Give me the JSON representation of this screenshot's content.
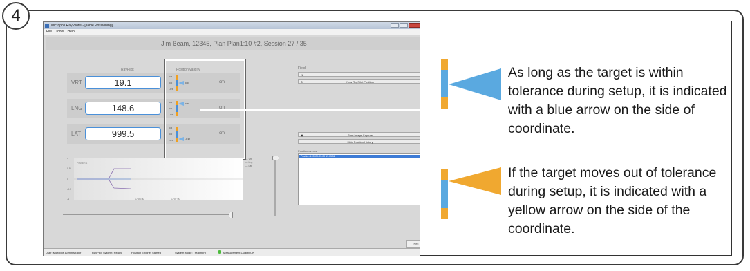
{
  "step_number": "4",
  "window": {
    "title": "Micropos RayPilot® - [Table Positioning]",
    "menu": [
      "File",
      "Tools",
      "Help"
    ],
    "header": "Jim Beam, 12345, Plan Plan1:10 #2, Session 27 / 35",
    "col_raypilot": "RayPilot",
    "col_position_validity": "Position validity",
    "rows": [
      {
        "label": "VRT",
        "value": "19.1",
        "unit": "cm",
        "pv_value": "0.03"
      },
      {
        "label": "LNG",
        "value": "148.6",
        "unit": "cm",
        "pv_value": "0.50"
      },
      {
        "label": "LAT",
        "value": "999.5",
        "unit": "cm",
        "pv_value": "-0.38"
      }
    ],
    "pv_ticks": [
      "0.5",
      "0.0",
      "-0.5"
    ],
    "field_label": "Field",
    "field_value": "f1",
    "new_position_button": "New RayPilot Position",
    "start_capture_button": "Start Image Capture",
    "hide_history_button": "Hide Position History",
    "events_label": "Position events",
    "events_selected": "Position 1: 2020-05-29 17:05:52",
    "chart_title": "Position 1",
    "chart_y_ticks": [
      "1",
      "0.5",
      "0",
      "-0.5",
      "-1"
    ],
    "chart_x_ticks": [
      "17:06:30",
      "17:07:00"
    ],
    "legend": [
      "Vrt",
      "Lng",
      "Lat"
    ],
    "next_button": "Nex",
    "status": [
      "User: Micropos Administrator",
      "RayPilot System: Ready",
      "Position Engine: Started",
      "System Mode: Treatment",
      "Measurement Quality OK"
    ]
  },
  "panel": {
    "text_blue": "As long as the target is within tolerance during setup, it is indicated with a blue arrow on the side of coordinate.",
    "text_yellow": "If the target moves out of tolerance during setup, it is indicated with a yellow arrow on the side of the coordinate."
  },
  "colors": {
    "blue": "#5aa9e0",
    "yellow": "#f0a830"
  }
}
